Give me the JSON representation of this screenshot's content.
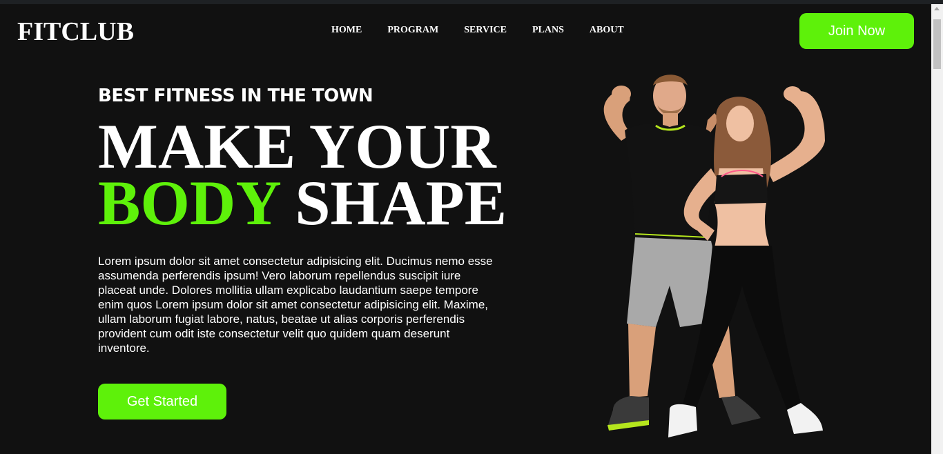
{
  "brand": {
    "logo": "FITCLUB"
  },
  "nav": {
    "items": [
      "HOME",
      "PROGRAM",
      "SERVICE",
      "PLANS",
      "ABOUT"
    ]
  },
  "header": {
    "join_label": "Join Now"
  },
  "hero": {
    "tagline": "BEST FITNESS IN THE TOWN",
    "headline_line1": "MAKE YOUR",
    "headline_accent": "BODY",
    "headline_line2_rest": "SHAPE",
    "description": "Lorem ipsum dolor sit amet consectetur adipisicing elit. Ducimus nemo esse assumenda perferendis ipsum! Vero laborum repellendus suscipit iure placeat unde. Dolores mollitia ullam explicabo laudantium saepe tempore enim quos Lorem ipsum dolor sit amet consectetur adipisicing elit. Maxime, ullam laborum fugiat labore, natus, beatae ut alias corporis perferendis provident cum odit iste consectetur velit quo quidem quam deserunt inventore.",
    "cta_label": "Get Started"
  },
  "colors": {
    "background": "#111111",
    "accent": "#5ef10a",
    "text": "#ffffff"
  }
}
